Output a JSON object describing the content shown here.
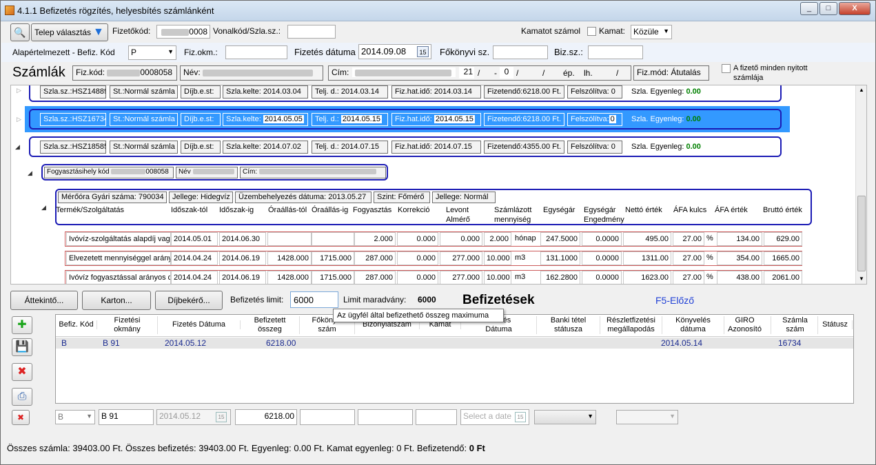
{
  "window": {
    "title": "4.1.1 Befizetés rögzítés, helyesbítés számlánként",
    "min": "_",
    "max": "□",
    "close": "X"
  },
  "toolbar": {
    "telep_btn": "Telep választás",
    "fizetokod_label": "Fizetőkód:",
    "fizetokod_value": "0008",
    "vonalkod_label": "Vonalkód/Szla.sz.:",
    "vonalkod_value": "",
    "kamatot_label": "Kamatot számol",
    "kamat_label": "Kamat:",
    "kamat_value": "Közüle"
  },
  "row2": {
    "alap_label": "Alapértelmezett - Befiz. Kód",
    "alap_value": "P",
    "fizokm_label": "Fiz.okm.:",
    "fizokm_value": "",
    "datum_label": "Fizetés dátuma",
    "datum_value": "2014.09.08",
    "cal_icon": "15",
    "fokonyvi_label": "Főkönyvi sz.",
    "fokonyvi_value": "",
    "bizsz_label": "Biz.sz.:",
    "bizsz_value": ""
  },
  "szamlak": {
    "title": "Számlák",
    "fizkod_label": "Fiz.kód:",
    "fizkod_value": "0008058",
    "nev_label": "Név:",
    "cim_label": "Cím:",
    "num1": "21",
    "slash": "/",
    "dash": "-",
    "num2": "0",
    "ep": "ép.",
    "lh": "lh.",
    "fizmod_label": "Fiz.mód:",
    "fizmod_value": "Átutalás",
    "checkbox_label": "A fizető minden nyitott számlája"
  },
  "invoices": [
    {
      "szlasz": "Szla.sz.:HSZ14889",
      "st": "St.:Normál számla",
      "dij": "Díjb.e.st:",
      "kelte_label": "Szla.kelte:",
      "kelte": "2014.03.04",
      "telj_label": "Telj. d.:",
      "telj": "2014.03.14",
      "hat_label": "Fiz.hat.idő:",
      "hat": "2014.03.14",
      "fizetendo": "Fizetendő:6218.00 Ft.",
      "felsz_label": "Felszólítva:",
      "felsz": "0",
      "egy_label": "Szla. Egyenleg:",
      "egy": "0.00"
    },
    {
      "szlasz": "Szla.sz.:HSZ16734",
      "st": "St.:Normál számla",
      "dij": "Díjb.e.st:",
      "kelte_label": "Szla.kelte:",
      "kelte": "2014.05.05",
      "telj_label": "Telj. d.:",
      "telj": "2014.05.15",
      "hat_label": "Fiz.hat.idő:",
      "hat": "2014.05.15",
      "fizetendo": "Fizetendő:6218.00 Ft.",
      "felsz_label": "Felszólítva:",
      "felsz": "0",
      "egy_label": "Szla. Egyenleg:",
      "egy": "0.00"
    },
    {
      "szlasz": "Szla.sz.:HSZ18585",
      "st": "St.:Normál számla",
      "dij": "Díjb.e.st:",
      "kelte_label": "Szla.kelte:",
      "kelte": "2014.07.02",
      "telj_label": "Telj. d.:",
      "telj": "2014.07.15",
      "hat_label": "Fiz.hat.idő:",
      "hat": "2014.07.15",
      "fizetendo": "Fizetendő:4355.00 Ft.",
      "felsz_label": "Felszólítva:",
      "felsz": "0",
      "egy_label": "Szla. Egyenleg:",
      "egy": "0.00"
    }
  ],
  "fogy": {
    "kod_label": "Fogyasztásihely kód",
    "kod_value": "008058",
    "nev_label": "Név",
    "cim_label": "Cím:"
  },
  "meter": {
    "gyari": "Mérőóra Gyári száma: 790034",
    "jelleg": "Jellege: Hidegvíz",
    "uzem": "Üzembehelyezés dátuma: 2013.05.27",
    "szint": "Szint: Főmérő",
    "jelleg2": "Jellege: Normál"
  },
  "items_headers": [
    "Termék/Szolgáltatás",
    "Időszak-tól",
    "Időszak-ig",
    "Óraállás-tól",
    "Óraállás-ig",
    "Fogyasztás",
    "Korrekció",
    "Levont\nAlmérő",
    "Számlázott\nmennyiség",
    "Egységár",
    "Egységár\nEngedmény",
    "Nettó érték",
    "ÁFA kulcs",
    "ÁFA érték",
    "Bruttó érték"
  ],
  "items": [
    {
      "name": "Ivóvíz-szolgáltatás alapdíj vagy",
      "tol": "2014.05.01",
      "ig": "2014.06.30",
      "oratol": "",
      "oraig": "",
      "fogy": "2.000",
      "korr": "0.000",
      "levont": "0.000",
      "menny": "2.000",
      "unit": "hónap",
      "egysar": "247.5000",
      "eng": "0.0000",
      "netto": "495.00",
      "afa_kulcs": "27.00",
      "pct": "%",
      "afa": "134.00",
      "brutto": "629.00"
    },
    {
      "name": "Elvezetett mennyiséggel arányo",
      "tol": "2014.04.24",
      "ig": "2014.06.19",
      "oratol": "1428.000",
      "oraig": "1715.000",
      "fogy": "287.000",
      "korr": "0.000",
      "levont": "277.000",
      "menny": "10.000",
      "unit": "m3",
      "egysar": "131.1000",
      "eng": "0.0000",
      "netto": "1311.00",
      "afa_kulcs": "27.00",
      "pct": "%",
      "afa": "354.00",
      "brutto": "1665.00"
    },
    {
      "name": "Ivóvíz fogyasztással arányos díj",
      "tol": "2014.04.24",
      "ig": "2014.06.19",
      "oratol": "1428.000",
      "oraig": "1715.000",
      "fogy": "287.000",
      "korr": "0.000",
      "levont": "277.000",
      "menny": "10.000",
      "unit": "m3",
      "egysar": "162.2800",
      "eng": "0.0000",
      "netto": "1623.00",
      "afa_kulcs": "27.00",
      "pct": "%",
      "afa": "438.00",
      "brutto": "2061.00"
    }
  ],
  "actions": {
    "attekinto": "Áttekintő...",
    "karton": "Karton...",
    "dijbekero": "Díjbekérő...",
    "limit_label": "Befizetés limit:",
    "limit_value": "6000",
    "marad_label": "Limit maradvány:",
    "marad_value": "6000",
    "befizetesek": "Befizetések",
    "f5": "F5-Előző",
    "tooltip": "Az ügyfél által befizethető összeg maximuma"
  },
  "grid": {
    "headers": [
      "Befiz. Kód",
      "Fizetési\nokmány",
      "Fizetés Dátuma",
      "Befizetett\nösszeg",
      "Főkönyvi\nszám",
      "Bizonylatszám",
      "Kamat",
      "Fizetés\nDátuma",
      "Banki tétel\nstátusza",
      "Részletfizetési\nmegállapodás",
      "Könyvelés\ndátuma",
      "GIRO\nAzonosító",
      "Számla\nszám",
      "Státusz"
    ],
    "rows": [
      {
        "kod": "B",
        "okm": "B 91",
        "datum": "2014.05.12",
        "osszeg": "6218.00",
        "konyv": "2014.05.14",
        "szamla": "16734"
      }
    ]
  },
  "edit": {
    "kod": "B",
    "okm": "B 91",
    "datum": "2014.05.12",
    "osszeg": "6218.00",
    "date_placeholder": "Select a date",
    "cal": "15"
  },
  "footer": {
    "osszes_szamla_label": "Összes számla:",
    "osszes_szamla": "39403.00 Ft.",
    "osszes_bef_label": "Összes befizetés:",
    "osszes_bef": "39403.00 Ft.",
    "egyenleg_label": "Egyenleg:",
    "egyenleg": "0.00 Ft.",
    "kamat_label": "Kamat egyenleg:",
    "kamat": "0 Ft.",
    "befizetendo_label": "Befizetendő:",
    "befizetendo": "0 Ft"
  }
}
